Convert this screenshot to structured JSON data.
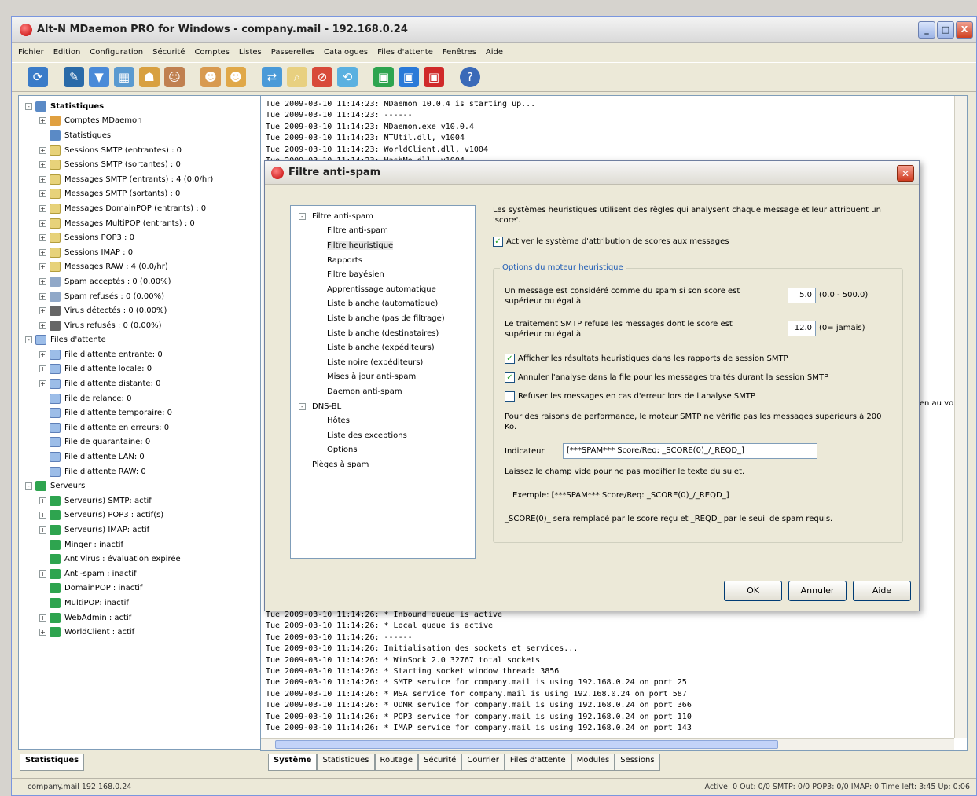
{
  "window": {
    "title": "Alt-N MDaemon PRO for Windows - company.mail - 192.168.0.24",
    "buttons": {
      "minimize": "_",
      "maximize": "□",
      "close": "X"
    }
  },
  "menu": [
    "Fichier",
    "Edition",
    "Configuration",
    "Sécurité",
    "Comptes",
    "Listes",
    "Passerelles",
    "Catalogues",
    "Files d'attente",
    "Fenêtres",
    "Aide"
  ],
  "tree": {
    "items": [
      {
        "label": "Statistiques",
        "exp": "-",
        "icon": "stats",
        "indent": 0,
        "bold": true
      },
      {
        "label": "Comptes MDaemon",
        "exp": "+",
        "icon": "user",
        "indent": 1
      },
      {
        "label": "Statistiques",
        "exp": "",
        "icon": "stats",
        "indent": 1
      },
      {
        "label": "Sessions SMTP (entrantes) : 0",
        "exp": "+",
        "icon": "folder",
        "indent": 1
      },
      {
        "label": "Sessions SMTP (sortantes) : 0",
        "exp": "+",
        "icon": "folder",
        "indent": 1
      },
      {
        "label": "Messages SMTP (entrants) : 4 (0.0/hr)",
        "exp": "+",
        "icon": "folder",
        "indent": 1
      },
      {
        "label": "Messages SMTP (sortants) : 0",
        "exp": "+",
        "icon": "folder",
        "indent": 1
      },
      {
        "label": "Messages DomainPOP (entrants) : 0",
        "exp": "+",
        "icon": "folder",
        "indent": 1
      },
      {
        "label": "Messages MultiPOP (entrants) : 0",
        "exp": "+",
        "icon": "folder",
        "indent": 1
      },
      {
        "label": "Sessions POP3 : 0",
        "exp": "+",
        "icon": "folder",
        "indent": 1
      },
      {
        "label": "Sessions IMAP : 0",
        "exp": "+",
        "icon": "folder",
        "indent": 1
      },
      {
        "label": "Messages RAW : 4 (0.0/hr)",
        "exp": "+",
        "icon": "folder",
        "indent": 1
      },
      {
        "label": "Spam acceptés : 0 (0.00%)",
        "exp": "+",
        "icon": "spam",
        "indent": 1
      },
      {
        "label": "Spam refusés : 0 (0.00%)",
        "exp": "+",
        "icon": "spam",
        "indent": 1
      },
      {
        "label": "Virus détectés : 0 (0.00%)",
        "exp": "+",
        "icon": "virus",
        "indent": 1
      },
      {
        "label": "Virus refusés : 0 (0.00%)",
        "exp": "+",
        "icon": "virus",
        "indent": 1
      },
      {
        "label": "Files d'attente",
        "exp": "-",
        "icon": "queue",
        "indent": 0
      },
      {
        "label": "File d'attente entrante: 0",
        "exp": "+",
        "icon": "queue",
        "indent": 1
      },
      {
        "label": "File d'attente locale: 0",
        "exp": "+",
        "icon": "queue",
        "indent": 1
      },
      {
        "label": "File d'attente distante: 0",
        "exp": "+",
        "icon": "queue",
        "indent": 1
      },
      {
        "label": "File de relance: 0",
        "exp": "",
        "icon": "queue",
        "indent": 1
      },
      {
        "label": "File d'attente temporaire: 0",
        "exp": "",
        "icon": "queue",
        "indent": 1
      },
      {
        "label": "File d'attente en erreurs: 0",
        "exp": "",
        "icon": "queue",
        "indent": 1
      },
      {
        "label": "File de quarantaine: 0",
        "exp": "",
        "icon": "queue",
        "indent": 1
      },
      {
        "label": "File d'attente LAN: 0",
        "exp": "",
        "icon": "queue",
        "indent": 1
      },
      {
        "label": "File d'attente RAW: 0",
        "exp": "",
        "icon": "queue",
        "indent": 1
      },
      {
        "label": "Serveurs",
        "exp": "-",
        "icon": "server",
        "indent": 0
      },
      {
        "label": "Serveur(s) SMTP: actif",
        "exp": "+",
        "icon": "server",
        "indent": 1
      },
      {
        "label": "Serveur(s) POP3 : actif(s)",
        "exp": "+",
        "icon": "server",
        "indent": 1
      },
      {
        "label": "Serveur(s) IMAP: actif",
        "exp": "+",
        "icon": "server",
        "indent": 1
      },
      {
        "label": "Minger : inactif",
        "exp": "",
        "icon": "server",
        "indent": 1
      },
      {
        "label": "AntiVirus : évaluation expirée",
        "exp": "",
        "icon": "server",
        "indent": 1
      },
      {
        "label": "Anti-spam : inactif",
        "exp": "+",
        "icon": "server",
        "indent": 1
      },
      {
        "label": "DomainPOP : inactif",
        "exp": "",
        "icon": "server",
        "indent": 1
      },
      {
        "label": "MultiPOP: inactif",
        "exp": "",
        "icon": "server",
        "indent": 1
      },
      {
        "label": "WebAdmin : actif",
        "exp": "+",
        "icon": "server",
        "indent": 1
      },
      {
        "label": "WorldClient : actif",
        "exp": "+",
        "icon": "server",
        "indent": 1
      }
    ]
  },
  "log": {
    "top": [
      "Tue 2009-03-10 11:14:23: MDaemon 10.0.4 is starting up...",
      "Tue 2009-03-10 11:14:23: ------",
      "Tue 2009-03-10 11:14:23: MDaemon.exe v10.0.4",
      "Tue 2009-03-10 11:14:23: NTUtil.dll, v1004",
      "Tue 2009-03-10 11:14:23: WorldClient.dll, v1004",
      "Tue 2009-03-10 11:14:23: HashMe.dll, v1004"
    ],
    "bottom": [
      "Tue 2009-03-10 11:14:26: * Inbound queue is active",
      "Tue 2009-03-10 11:14:26: * Local queue is active",
      "Tue 2009-03-10 11:14:26: ------",
      "Tue 2009-03-10 11:14:26: Initialisation des sockets et services...",
      "Tue 2009-03-10 11:14:26: * WinSock 2.0 32767 total sockets",
      "Tue 2009-03-10 11:14:26: * Starting socket window thread: 3856",
      "Tue 2009-03-10 11:14:26: * SMTP service for company.mail is using 192.168.0.24 on port 25",
      "Tue 2009-03-10 11:14:26: * MSA service for company.mail is using 192.168.0.24 on port 587",
      "Tue 2009-03-10 11:14:26: * ODMR service for company.mail is using 192.168.0.24 on port 366",
      "Tue 2009-03-10 11:14:26: * POP3 service for company.mail is using 192.168.0.24 on port 110",
      "Tue 2009-03-10 11:14:26: * IMAP service for company.mail is using 192.168.0.24 on port 143"
    ],
    "side_text": "en au vol"
  },
  "tabs_left": [
    "Statistiques"
  ],
  "tabs_right": [
    "Système",
    "Statistiques",
    "Routage",
    "Sécurité",
    "Courrier",
    "Files d'attente",
    "Modules",
    "Sessions"
  ],
  "statusbar": {
    "left": "company.mail 192.168.0.24",
    "right": "Active: 0   Out: 0/0   SMTP: 0/0   POP3: 0/0   IMAP: 0   Time left: 3:45   Up: 0:06"
  },
  "dialog": {
    "title": "Filtre anti-spam",
    "nav": [
      {
        "label": "Filtre anti-spam",
        "lvl": 1,
        "exp": "-"
      },
      {
        "label": "Filtre anti-spam",
        "lvl": 2
      },
      {
        "label": "Filtre heuristique",
        "lvl": 2,
        "selected": true
      },
      {
        "label": "Rapports",
        "lvl": 2
      },
      {
        "label": "Filtre bayésien",
        "lvl": 2
      },
      {
        "label": "Apprentissage automatique",
        "lvl": 2
      },
      {
        "label": "Liste blanche (automatique)",
        "lvl": 2
      },
      {
        "label": "Liste blanche (pas de filtrage)",
        "lvl": 2
      },
      {
        "label": "Liste blanche (destinataires)",
        "lvl": 2
      },
      {
        "label": "Liste blanche (expéditeurs)",
        "lvl": 2
      },
      {
        "label": "Liste noire (expéditeurs)",
        "lvl": 2
      },
      {
        "label": "Mises à jour anti-spam",
        "lvl": 2
      },
      {
        "label": "Daemon anti-spam",
        "lvl": 2
      },
      {
        "label": "DNS-BL",
        "lvl": 1,
        "exp": "-"
      },
      {
        "label": "Hôtes",
        "lvl": 2
      },
      {
        "label": "Liste des exceptions",
        "lvl": 2
      },
      {
        "label": "Options",
        "lvl": 2
      },
      {
        "label": "Pièges à spam",
        "lvl": 1
      }
    ],
    "intro": "Les systèmes heuristiques utilisent des règles qui analysent chaque message et leur attribuent un 'score'.",
    "enable_label": "Activer le système d'attribution de scores aux messages",
    "group_title": "Options du moteur heuristique",
    "spam_score_label": "Un message est considéré comme du spam si son score est supérieur ou égal à",
    "spam_score_value": "5.0",
    "spam_score_note": "(0.0 - 500.0)",
    "reject_label": "Le traitement SMTP refuse les messages dont le score est supérieur ou égal à",
    "reject_value": "12.0",
    "reject_note": "(0= jamais)",
    "check1": "Afficher les résultats heuristiques dans les rapports de session SMTP",
    "check2": "Annuler l'analyse dans la file pour les messages traités durant la session SMTP",
    "check3": "Refuser les messages en cas d'erreur lors de l'analyse SMTP",
    "perf_note": "Pour des raisons de performance, le moteur SMTP ne vérifie pas les messages supérieurs à 200 Ko.",
    "indicator_label": "Indicateur",
    "indicator_value": "[***SPAM*** Score/Req: _SCORE(0)_/_REQD_]",
    "blank_note": "Laissez le champ vide pour ne pas modifier le texte du sujet.",
    "example": "Exemple:  [***SPAM*** Score/Req: _SCORE(0)_/_REQD_]",
    "explain": "_SCORE(0)_ sera remplacé par le score reçu et _REQD_ par le seuil de spam requis.",
    "ok": "OK",
    "cancel": "Annuler",
    "help": "Aide"
  },
  "colors": {
    "accent": "#1d5ab5",
    "close": "#cf3b20",
    "server": "#2ea44f"
  }
}
